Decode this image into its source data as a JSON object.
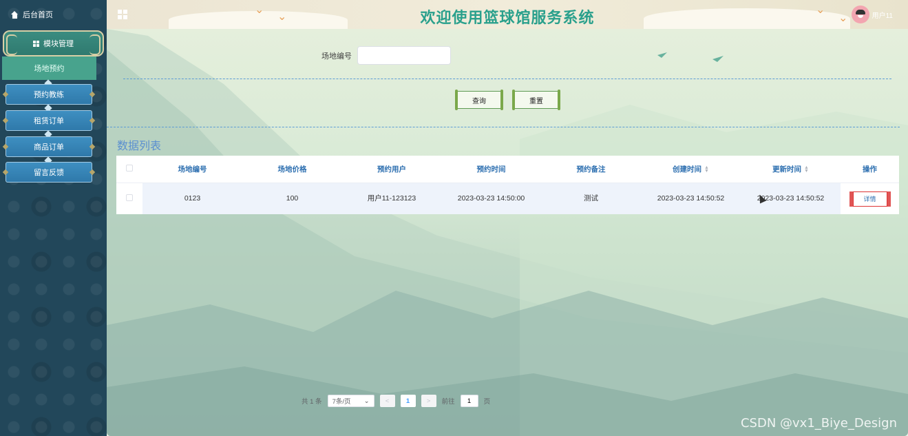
{
  "sidebar": {
    "home_label": "后台首页",
    "module_label": "模块管理",
    "active_item": "场地预约",
    "items": [
      {
        "label": "预约教练"
      },
      {
        "label": "租赁订单"
      },
      {
        "label": "商品订单"
      },
      {
        "label": "留言反馈"
      }
    ]
  },
  "header": {
    "title": "欢迎使用篮球馆服务系统",
    "username": "用户11"
  },
  "search": {
    "field_label": "场地编号",
    "field_value": "",
    "field_placeholder": "",
    "query_button": "查询",
    "reset_button": "重置"
  },
  "list": {
    "title": "数据列表",
    "columns": [
      "场地编号",
      "场地价格",
      "预约用户",
      "预约时间",
      "预约备注",
      "创建时间",
      "更新时间",
      "操作"
    ],
    "rows": [
      {
        "venue_no": "0123",
        "price": "100",
        "user": "用户11-123123",
        "booking_time": "2023-03-23 14:50:00",
        "note": "测试",
        "created": "2023-03-23 14:50:52",
        "updated": "2023-03-23 14:50:52",
        "action": "详情"
      }
    ]
  },
  "pagination": {
    "total_text": "共 1 条",
    "page_size": "7条/页",
    "prev": "<",
    "current_page": "1",
    "next": ">",
    "goto_label": "前往",
    "goto_value": "1",
    "page_suffix": "页"
  },
  "watermark": "CSDN @vx1_Biye_Design",
  "colors": {
    "title_green": "#2aa08c",
    "sidebar_bg": "#22475a",
    "menu_blue": "#3e8fc1",
    "active_green": "#48a38d",
    "header_text_blue": "#2d6fb0"
  }
}
